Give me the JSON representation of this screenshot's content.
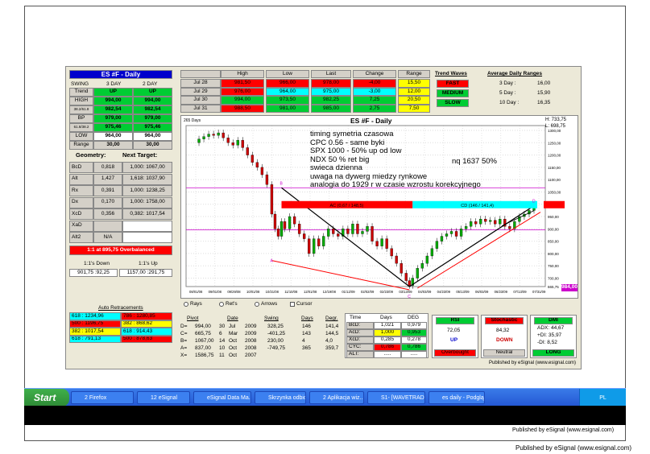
{
  "panel": {
    "title": "ES #F - Daily",
    "swing": "SWING",
    "day3": "3 DAY",
    "day2": "2 DAY"
  },
  "swingrows": [
    {
      "label": "Trend",
      "v3": "UP",
      "v2": "UP",
      "c3": "#00cc33",
      "c2": "#00cc33"
    },
    {
      "label": "HIGH",
      "v3": "994,00",
      "v2": "994,00",
      "c3": "#00cc33",
      "c2": "#00cc33"
    },
    {
      "label": "38.2/61.8",
      "v3": "982,54",
      "v2": "982,54",
      "c3": "#00cc33",
      "c2": "#00cc33"
    },
    {
      "label": "BP",
      "v3": "979,00",
      "v2": "979,00",
      "c3": "#00cc33",
      "c2": "#00cc33"
    },
    {
      "label": "61.8/38.2",
      "v3": "975,46",
      "v2": "975,46",
      "c3": "#00cc33",
      "c2": "#00cc33"
    },
    {
      "label": "LOW",
      "v3": "964,00",
      "v2": "964,00",
      "c3": "#fff",
      "c2": "#fff"
    },
    {
      "label": "Range",
      "v3": "30,00",
      "v2": "30,00",
      "c3": "#d4d0c8",
      "c2": "#d4d0c8"
    }
  ],
  "geometry": {
    "title": "Geometry:",
    "next": "Next Target:",
    "rows": [
      {
        "label": "BcD",
        "a": "0,818",
        "b": "1,000: 1067,00"
      },
      {
        "label": "Alt",
        "a": "1,427",
        "b": "1,618: 1037,90"
      },
      {
        "label": "Rx",
        "a": "0,391",
        "b": "1,000: 1238,25"
      },
      {
        "label": "Dx",
        "a": "0,170",
        "b": "1,000: 1758,00"
      },
      {
        "label": "XcD",
        "a": "0,356",
        "b": "0,382: 1017,54"
      },
      {
        "label": "XaD",
        "a": "",
        "b": ""
      },
      {
        "label": "Alt2",
        "a": "N/A",
        "b": ""
      }
    ],
    "alert": "1:1 at 895,75 Overbalanced"
  },
  "updown": {
    "down_label": "1:1's Down",
    "up_label": "1:1's Up",
    "down": "901,75 :92,25",
    "up": "1157,00 :291,75"
  },
  "retrace": {
    "title": "Auto Retracements",
    "rows": [
      [
        "618 : 1234,96",
        "#00ffff",
        "786 : 1280,85",
        "#ff0000"
      ],
      [
        "500 : 1196,75",
        "#ff0000",
        "382 : 868,62",
        "#ffff00"
      ],
      [
        "382 : 1017,54",
        "#ffff00",
        "618 : 914,43",
        "#00ffff"
      ],
      [
        "618 : 791,13",
        "#00ffff",
        "500 : 878,63",
        "#ff0000"
      ]
    ]
  },
  "pricetable": {
    "headers": [
      "High",
      "Low",
      "Last",
      "Change",
      "Range"
    ],
    "rows": [
      {
        "date": "Jul 28",
        "high": "981,50",
        "low": "966,00",
        "last": "978,00",
        "chg": "-4,00",
        "rng": "15,50",
        "ch": "#ff0000",
        "cl": "#ff0000",
        "cla": "#ff0000",
        "cc": "#ff0000",
        "cr": "#ffff00"
      },
      {
        "date": "Jul 29",
        "high": "976,00",
        "low": "964,00",
        "last": "975,00",
        "chg": "-3,00",
        "rng": "12,00",
        "ch": "#ff0000",
        "cl": "#00ffff",
        "cla": "#00ffff",
        "cc": "#00ffff",
        "cr": "#ffff00"
      },
      {
        "date": "Jul 30",
        "high": "994,00",
        "low": "973,50",
        "last": "982,25",
        "chg": "7,25",
        "rng": "20,50",
        "ch": "#00cc33",
        "cl": "#00cc33",
        "cla": "#00cc33",
        "cc": "#00cc33",
        "cr": "#ffff00"
      },
      {
        "date": "Jul 31",
        "high": "988,50",
        "low": "981,00",
        "last": "985,00",
        "chg": "2,75",
        "rng": "7,50",
        "ch": "#ff0000",
        "cl": "#00cc33",
        "cla": "#00cc33",
        "cc": "#00cc33",
        "cr": "#ffff00"
      }
    ]
  },
  "trendwaves": {
    "title": "Trend Waves",
    "fast": "FAST",
    "medium": "MEDIUM",
    "slow": "SLOW"
  },
  "adr": {
    "title": "Average Daily Ranges",
    "rows": [
      [
        "3 Day :",
        "16,00"
      ],
      [
        "5 Day :",
        "15,90"
      ],
      [
        "10 Day :",
        "16,35"
      ]
    ]
  },
  "chart": {
    "title": "ES #F - Daily",
    "days": "265 Days",
    "hi": "H: 733,75",
    "lo": "L: 698,75",
    "lastprice": "984,00",
    "annot": [
      "timing symetria czasowa",
      "CPC 0.56 - same byki",
      "SPX 1000 - 50% up od low",
      "NDX 50 % ret big",
      "swieca dzienna",
      "uwaga na dywerg miedzy rynkowe",
      "analogia do 1929 r w czasie wzrostu korekcyjnego"
    ],
    "nq": "nq 1637 50%",
    "ac": "AC (0,67 / 148,5)",
    "cd": "CD (146 / 141,4)",
    "yticks": [
      "1300,00",
      "1250,00",
      "1200,00",
      "1150,00",
      "1100,00",
      "1050,00",
      "1000,00",
      "950,00",
      "900,00",
      "850,00",
      "800,00",
      "750,00",
      "700,00",
      "665,75"
    ],
    "xticks": [
      "08/01/08",
      "09/01/08",
      "09/29/08",
      "10/01/08",
      "10/21/08",
      "11/10/08",
      "12/01/08",
      "12/19/08",
      "01/12/09",
      "02/02/09",
      "02/23/09",
      "03/13/09",
      "04/03/09",
      "04/23/09",
      "05/13/09",
      "06/03/09",
      "06/23/09",
      "07/13/09",
      "07/31/09"
    ],
    "labels": {
      "A": "A",
      "B": "B",
      "C": "C",
      "D": "D"
    }
  },
  "radios": [
    "Rays",
    "Ret's",
    "Arrows",
    "Cursor"
  ],
  "pivot": {
    "headers": [
      "Pivot",
      "Date",
      "Swing",
      "Days",
      "Degr."
    ],
    "rows": [
      [
        "D=",
        "994,00",
        "30",
        "Jul",
        "2009",
        "328,25",
        "146",
        "141,4"
      ],
      [
        "C=",
        "665,75",
        "6",
        "Mar",
        "2009",
        "-401,25",
        "143",
        "144,5"
      ],
      [
        "B=",
        "1067,00",
        "14",
        "Oct",
        "2008",
        "230,00",
        "4",
        "4,0"
      ],
      [
        "A=",
        "837,00",
        "10",
        "Oct",
        "2008",
        "-749,75",
        "365",
        "359,7"
      ],
      [
        "X=",
        "1586,75",
        "11",
        "Oct",
        "2007",
        "",
        "",
        ""
      ]
    ]
  },
  "timebox": {
    "headers": [
      "Time",
      "Days",
      "DEG"
    ],
    "rows": [
      [
        "BcD:",
        "1,021",
        "0,979",
        "#fff",
        "#fff"
      ],
      [
        "AcD:",
        "1,000",
        "0,953",
        "#ffff00",
        "#00cc33"
      ],
      [
        "XcD:",
        "0,285",
        "0,278",
        "#fff",
        "#fff"
      ],
      [
        "CYC:",
        "0,786",
        "0,786",
        "#ff0000",
        "#00cc33"
      ],
      [
        "ALT:",
        ".....",
        ".....",
        "#fff",
        "#fff"
      ]
    ]
  },
  "rsi": {
    "title": "RSI",
    "value": "72,05",
    "dir": "UP",
    "state": "Overbought"
  },
  "stoch": {
    "title": "Stochastic",
    "value": "84,32",
    "dir": "DOWN",
    "state": "Neutral"
  },
  "dmi": {
    "title": "DMI",
    "adx": "ADX:  44,67",
    "pdi": "+DI:  35,97",
    "mdi": "-DI:  8,52",
    "state": "LONG"
  },
  "publish_inner": "Published by eSignal (www.esignal.com)",
  "publish_outer": "Published by eSignal (www.esignal.com)",
  "publish_bottom": "Published by eSignal (www.esignal.com)",
  "taskbar": {
    "start": "Start",
    "items": [
      "2 Firefox",
      "12 eSignal",
      "eSignal Data Ma...",
      "Skrzynka odbiorc...",
      "2 Aplikacja wiz...",
      "S1- [WAVETRAD...",
      "es daily - Podglą..."
    ],
    "lang": "PL"
  }
}
